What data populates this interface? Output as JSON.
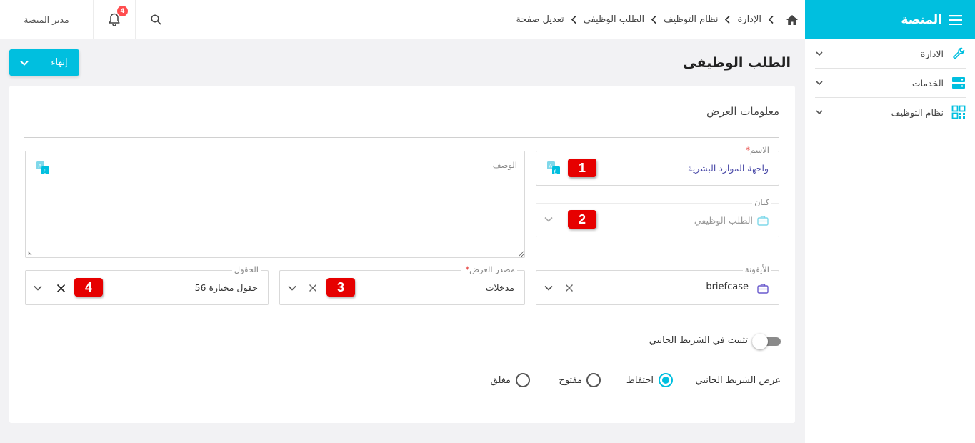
{
  "sidebar": {
    "title": "المنصة",
    "items": [
      {
        "label": "الادارة",
        "icon": "wrench-icon"
      },
      {
        "label": "الخدمات",
        "icon": "server-icon"
      },
      {
        "label": "نظام التوظيف",
        "icon": "qr-code-icon"
      }
    ]
  },
  "topbar": {
    "breadcrumbs": [
      "الإدارة",
      "نظام التوظيف",
      "الطلب الوظيفي",
      "تعديل صفحة"
    ],
    "notification_count": "4",
    "user_label": "مدير المنصة"
  },
  "page": {
    "title": "الطلب الوظيفى",
    "finish_label": "إنهاء"
  },
  "form": {
    "section_title": "معلومات العرض",
    "name": {
      "label": "الاسم",
      "value": "واجهة الموارد البشرية",
      "marker": "1"
    },
    "entity": {
      "label": "كيان",
      "placeholder": "الطلب الوظيفي",
      "marker": "2"
    },
    "description": {
      "label": "الوصف",
      "value": ""
    },
    "icon": {
      "label": "الأيقونة",
      "value": "briefcase"
    },
    "display_source": {
      "label": "مصدر العرض",
      "value": "مدخلات",
      "marker": "3"
    },
    "fields": {
      "label": "الحقول",
      "value": "56 حقول مختارة",
      "marker": "4"
    },
    "pin_sidebar": {
      "label": "تثبيت في الشريط الجانبي",
      "on": false
    },
    "sidebar_display": {
      "label": "عرض الشريط الجانبي",
      "options": [
        {
          "label": "احتفاظ",
          "selected": true
        },
        {
          "label": "مفتوح",
          "selected": false
        },
        {
          "label": "مغلق",
          "selected": false
        }
      ]
    }
  },
  "colors": {
    "accent": "#00bfdf",
    "marker": "#e60000",
    "badge": "#ff4d4f"
  }
}
